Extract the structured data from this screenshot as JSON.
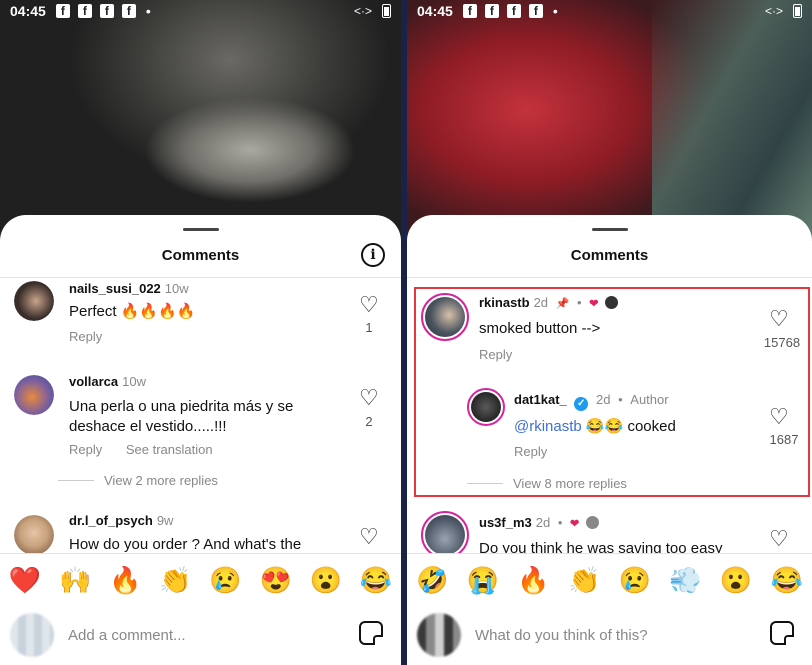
{
  "status": {
    "time": "04:45",
    "notif_icons": [
      "f",
      "f",
      "f",
      "f"
    ],
    "dot": "•",
    "data_icon": "<·>"
  },
  "left": {
    "title": "Comments",
    "comments": [
      {
        "username": "nails_susi_022",
        "time": "10w",
        "text": "Perfect 🔥🔥🔥🔥",
        "reply": "Reply",
        "likes": "1",
        "avatar_color": "#3a2e2a"
      },
      {
        "username": "vollarca",
        "time": "10w",
        "text": "Una perla o una piedrita más y se deshace el vestido.....!!!",
        "reply": "Reply",
        "translate": "See translation",
        "likes": "2",
        "more_replies": "View 2 more replies",
        "avatar_color": "#7a5ea0"
      },
      {
        "username": "dr.l_of_psych",
        "time": "9w",
        "text": "How do you order ? And what's the",
        "avatar_color": "#c9a27e"
      }
    ],
    "emojis": [
      "❤️",
      "🙌",
      "🔥",
      "👏",
      "😢",
      "😍",
      "😮",
      "😂"
    ],
    "input_placeholder": "Add a comment..."
  },
  "right": {
    "title": "Comments",
    "comments": [
      {
        "username": "rkinastb",
        "time": "2d",
        "text": "smoked button -->",
        "reply": "Reply",
        "likes": "15768",
        "avatar_color": "#4a5560"
      },
      {
        "username": "dat1kat_",
        "time": "2d",
        "author_tag": "Author",
        "mention": "@rkinastb",
        "text": "😂😂 cooked",
        "reply": "Reply",
        "likes": "1687",
        "more_replies": "View 8 more replies",
        "avatar_color": "#2d2d2d"
      },
      {
        "username": "us3f_m3",
        "time": "2d",
        "text": "Do you think he was saving too easy",
        "avatar_color": "#566070"
      }
    ],
    "emojis": [
      "🤣",
      "😭",
      "🔥",
      "👏",
      "😢",
      "💨",
      "😮",
      "😂"
    ],
    "input_placeholder": "What do you think of this?"
  },
  "colors": {
    "highlight": "#e2383e",
    "mention": "#3f6fd8",
    "verified": "#1d9bf0",
    "heart_red": "#e0245e"
  }
}
